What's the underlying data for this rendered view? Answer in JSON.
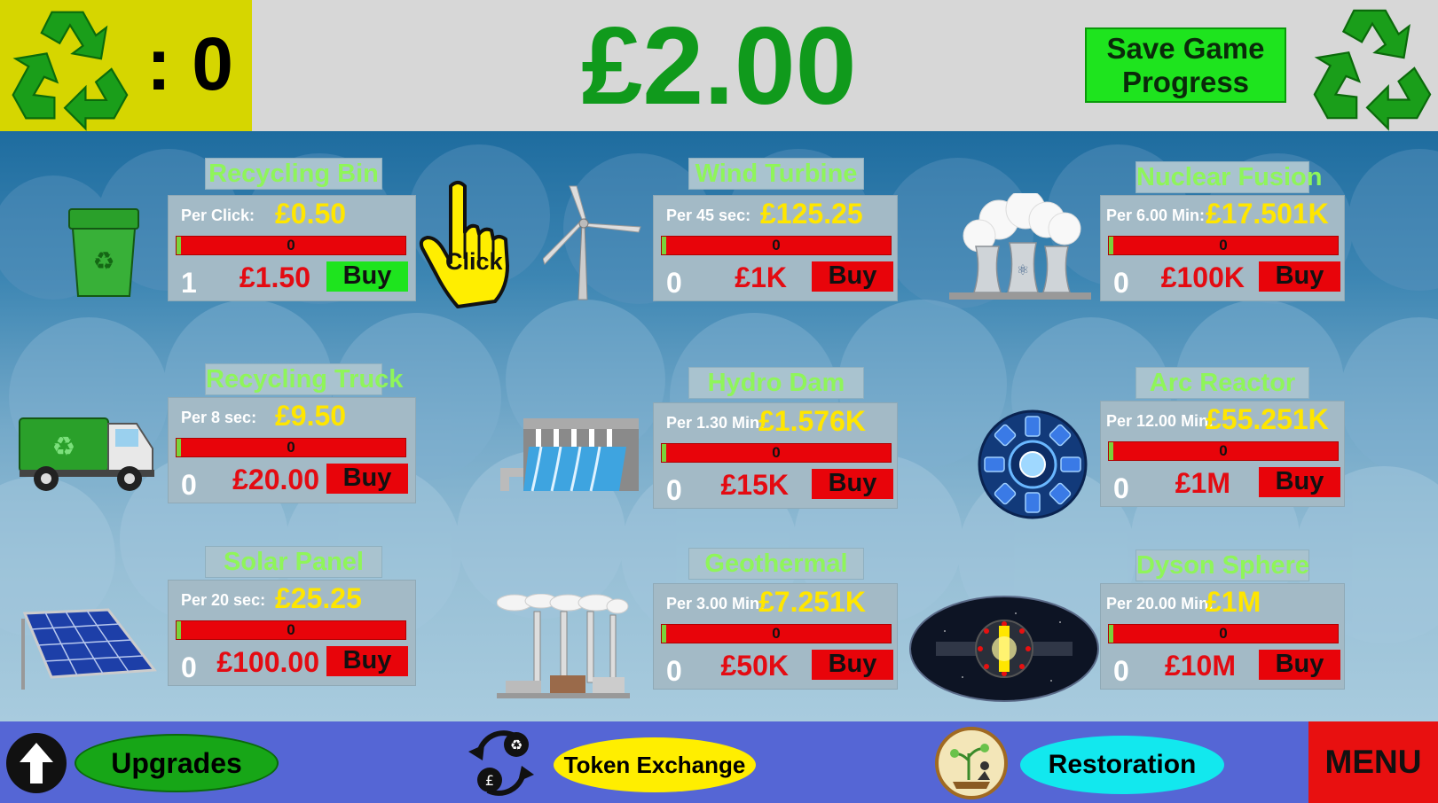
{
  "header": {
    "token_count": ": 0",
    "money": "£2.00",
    "save_button": "Save Game Progress"
  },
  "click_icon_label": "Click",
  "colors": {
    "money_green": "#109a1c",
    "token_box": "#d6d600",
    "buy_red": "#e8040a",
    "buy_green": "#1ee41e",
    "title_green": "#8ff55a",
    "rate_yellow": "#ffe600",
    "bottom_bar": "#5566d5"
  },
  "generators": [
    {
      "name": "Recycling Bin",
      "rate_label": "Per Click:",
      "rate_value": "£0.50",
      "progress": "0",
      "progress_fill": 0.02,
      "owned": "1",
      "cost": "£1.50",
      "buy_label": "Buy",
      "buy_enabled": true,
      "icon": "recycling-bin-icon"
    },
    {
      "name": "Wind Turbine",
      "rate_label": "Per 45 sec:",
      "rate_value": "£125.25",
      "progress": "0",
      "progress_fill": 0.02,
      "owned": "0",
      "cost": "£1K",
      "buy_label": "Buy",
      "buy_enabled": false,
      "icon": "wind-turbine-icon"
    },
    {
      "name": "Nuclear Fusion",
      "rate_label": "Per 6.00 Min:",
      "rate_value": "£17.501K",
      "progress": "0",
      "progress_fill": 0.02,
      "owned": "0",
      "cost": "£100K",
      "buy_label": "Buy",
      "buy_enabled": false,
      "icon": "nuclear-plant-icon"
    },
    {
      "name": "Recycling Truck",
      "rate_label": "Per 8 sec:",
      "rate_value": "£9.50",
      "progress": "0",
      "progress_fill": 0.02,
      "owned": "0",
      "cost": "£20.00",
      "buy_label": "Buy",
      "buy_enabled": false,
      "icon": "recycling-truck-icon"
    },
    {
      "name": "Hydro Dam",
      "rate_label": "Per 1.30 Min:",
      "rate_value": "£1.576K",
      "progress": "0",
      "progress_fill": 0.02,
      "owned": "0",
      "cost": "£15K",
      "buy_label": "Buy",
      "buy_enabled": false,
      "icon": "hydro-dam-icon"
    },
    {
      "name": "Arc Reactor",
      "rate_label": "Per 12.00 Min:",
      "rate_value": "£55.251K",
      "progress": "0",
      "progress_fill": 0.02,
      "owned": "0",
      "cost": "£1M",
      "buy_label": "Buy",
      "buy_enabled": false,
      "icon": "arc-reactor-icon"
    },
    {
      "name": "Solar Panel",
      "rate_label": "Per 20 sec:",
      "rate_value": "£25.25",
      "progress": "0",
      "progress_fill": 0.02,
      "owned": "0",
      "cost": "£100.00",
      "buy_label": "Buy",
      "buy_enabled": false,
      "icon": "solar-panel-icon"
    },
    {
      "name": "Geothermal",
      "rate_label": "Per 3.00 Min:",
      "rate_value": "£7.251K",
      "progress": "0",
      "progress_fill": 0.02,
      "owned": "0",
      "cost": "£50K",
      "buy_label": "Buy",
      "buy_enabled": false,
      "icon": "geothermal-plant-icon"
    },
    {
      "name": "Dyson Sphere",
      "rate_label": "Per 20.00 Min:",
      "rate_value": "£1M",
      "progress": "0",
      "progress_fill": 0.02,
      "owned": "0",
      "cost": "£10M",
      "buy_label": "Buy",
      "buy_enabled": false,
      "icon": "dyson-sphere-icon"
    }
  ],
  "bottom": {
    "upgrades": "Upgrades",
    "token_exchange": "Token Exchange",
    "restoration": "Restoration",
    "menu": "MENU"
  }
}
